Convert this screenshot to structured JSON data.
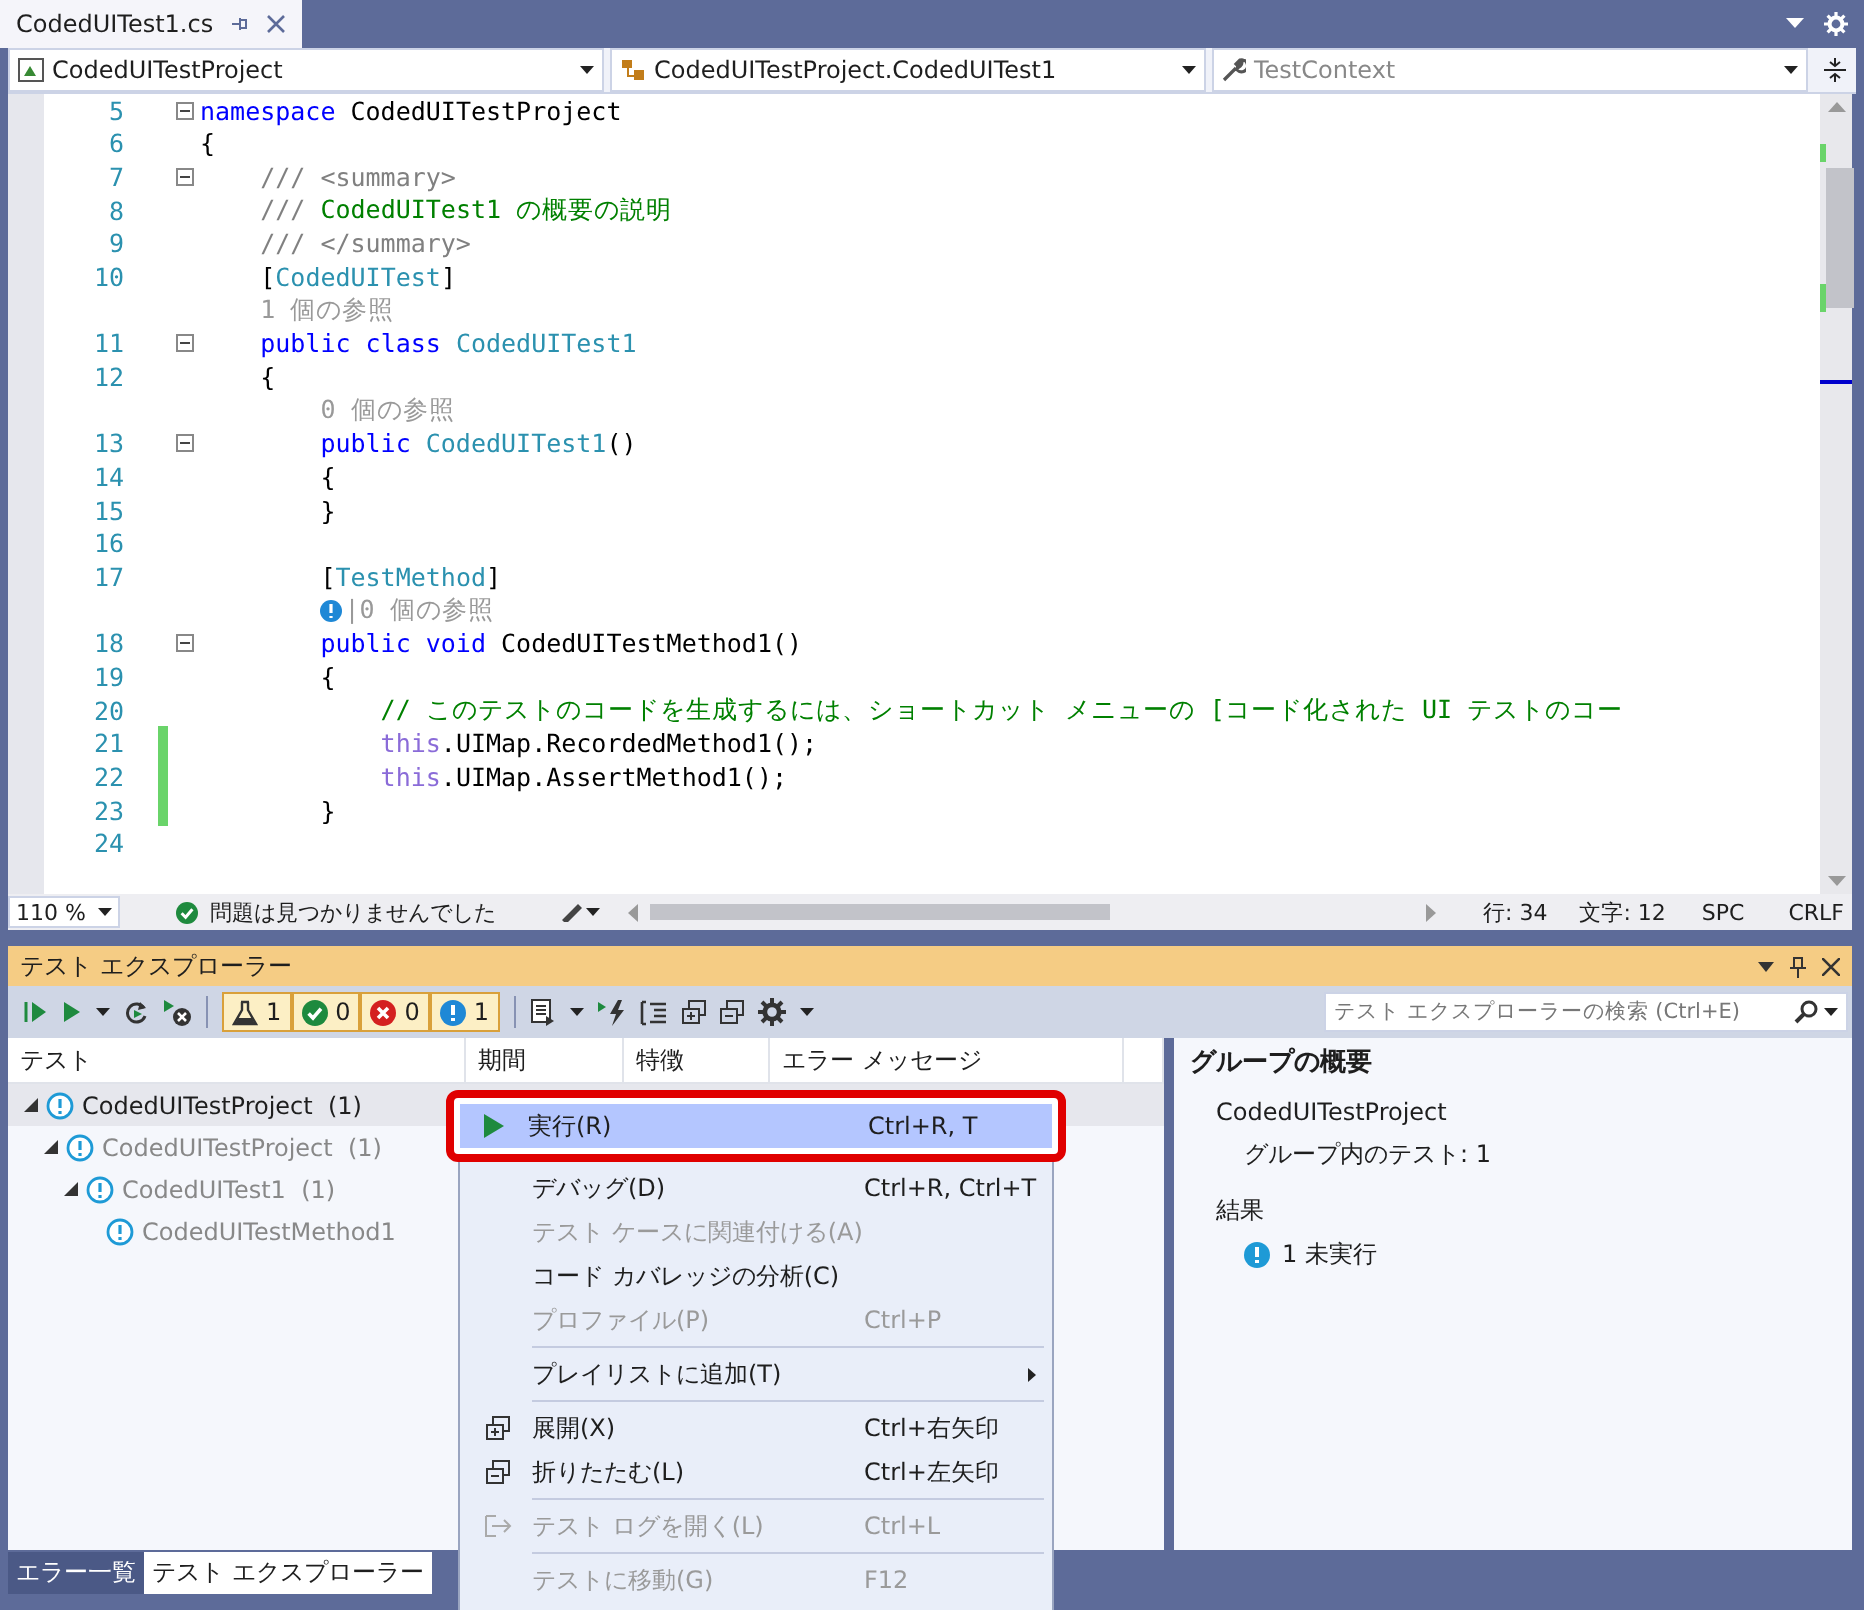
{
  "doc_tabs": [
    {
      "label": "CodedUITest1.cs",
      "selected": true
    }
  ],
  "nav_bar": {
    "dropdowns": [
      {
        "kind": "project",
        "text": "CodedUITestProject"
      },
      {
        "kind": "class",
        "text": "CodedUITestProject.CodedUITest1"
      },
      {
        "kind": "member",
        "text": "TestContext"
      }
    ]
  },
  "editor": {
    "lines": [
      {
        "kind": "code",
        "number": "5",
        "fold": true,
        "changed": false,
        "tokens": [
          {
            "kind": "keyword",
            "text": "namespace"
          },
          {
            "kind": "plain",
            "text": " CodedUITestProject"
          }
        ]
      },
      {
        "kind": "code",
        "number": "6",
        "fold": false,
        "changed": false,
        "tokens": [
          {
            "kind": "plain",
            "text": "{"
          }
        ]
      },
      {
        "kind": "code",
        "number": "7",
        "fold": true,
        "changed": false,
        "tokens": [
          {
            "kind": "doc",
            "text": "    /// <summary>"
          }
        ]
      },
      {
        "kind": "code",
        "number": "8",
        "fold": false,
        "changed": false,
        "tokens": [
          {
            "kind": "doc",
            "text": "    ///"
          },
          {
            "kind": "comment",
            "text": " CodedUITest1 の概要の説明"
          }
        ]
      },
      {
        "kind": "code",
        "number": "9",
        "fold": false,
        "changed": false,
        "tokens": [
          {
            "kind": "doc",
            "text": "    /// </summary>"
          }
        ]
      },
      {
        "kind": "code",
        "number": "10",
        "fold": false,
        "changed": false,
        "tokens": [
          {
            "kind": "plain",
            "text": "    ["
          },
          {
            "kind": "type",
            "text": "CodedUITest"
          },
          {
            "kind": "plain",
            "text": "]"
          }
        ]
      },
      {
        "kind": "lens",
        "text": "1 個の参照"
      },
      {
        "kind": "code",
        "number": "11",
        "fold": true,
        "changed": false,
        "tokens": [
          {
            "kind": "keyword",
            "text": "    public"
          },
          {
            "kind": "keyword",
            "text": " class"
          },
          {
            "kind": "type",
            "text": " CodedUITest1"
          }
        ]
      },
      {
        "kind": "code",
        "number": "12",
        "fold": false,
        "changed": false,
        "tokens": [
          {
            "kind": "plain",
            "text": "    {"
          }
        ]
      },
      {
        "kind": "lens",
        "text": "0 個の参照"
      },
      {
        "kind": "code",
        "number": "13",
        "fold": true,
        "changed": false,
        "tokens": [
          {
            "kind": "keyword",
            "text": "        public"
          },
          {
            "kind": "type",
            "text": " CodedUITest1"
          },
          {
            "kind": "plain",
            "text": "()"
          }
        ]
      },
      {
        "kind": "code",
        "number": "14",
        "fold": false,
        "changed": false,
        "tokens": [
          {
            "kind": "plain",
            "text": "        {"
          }
        ]
      },
      {
        "kind": "code",
        "number": "15",
        "fold": false,
        "changed": false,
        "tokens": [
          {
            "kind": "plain",
            "text": "        }"
          }
        ]
      },
      {
        "kind": "code",
        "number": "16",
        "fold": false,
        "changed": false
      },
      {
        "kind": "code",
        "number": "17",
        "fold": false,
        "changed": false,
        "tokens": [
          {
            "kind": "plain",
            "text": "        ["
          },
          {
            "kind": "type",
            "text": "TestMethod"
          },
          {
            "kind": "plain",
            "text": "]"
          }
        ]
      },
      {
        "kind": "lens_info",
        "text": "|0 個の参照"
      },
      {
        "kind": "code",
        "number": "18",
        "fold": true,
        "changed": false,
        "tokens": [
          {
            "kind": "keyword",
            "text": "        public"
          },
          {
            "kind": "keyword",
            "text": " void"
          },
          {
            "kind": "plain",
            "text": " CodedUITestMethod1()"
          }
        ]
      },
      {
        "kind": "code",
        "number": "19",
        "fold": false,
        "changed": false,
        "tokens": [
          {
            "kind": "plain",
            "text": "        {"
          }
        ]
      },
      {
        "kind": "code",
        "number": "20",
        "fold": false,
        "changed": false,
        "tokens": [
          {
            "kind": "comment",
            "text": "            // このテストのコードを生成するには、ショートカット メニューの [コード化された UI テストのコー"
          }
        ]
      },
      {
        "kind": "code",
        "number": "21",
        "fold": false,
        "changed": true,
        "tokens": [
          {
            "kind": "this",
            "text": "            this"
          },
          {
            "kind": "plain",
            "text": ".UIMap.RecordedMethod1();"
          }
        ]
      },
      {
        "kind": "code",
        "number": "22",
        "fold": false,
        "changed": true,
        "tokens": [
          {
            "kind": "this",
            "text": "            this"
          },
          {
            "kind": "plain",
            "text": ".UIMap.AssertMethod1();"
          }
        ]
      },
      {
        "kind": "code",
        "number": "23",
        "fold": false,
        "changed": true,
        "tokens": [
          {
            "kind": "plain",
            "text": "        }"
          }
        ]
      },
      {
        "kind": "code",
        "number": "24",
        "fold": false,
        "changed": false
      }
    ]
  },
  "editor_status": {
    "zoom": "110 %",
    "issues": "問題は見つかりませんでした",
    "line": "行: 34",
    "column": "文字: 12",
    "whitespace": "SPC",
    "line_ending": "CRLF"
  },
  "test_explorer": {
    "title": "テスト エクスプローラー",
    "filters": [
      {
        "kind": "all",
        "count": "1"
      },
      {
        "kind": "passed",
        "count": "0"
      },
      {
        "kind": "failed",
        "count": "0"
      },
      {
        "kind": "not_run",
        "count": "1"
      }
    ],
    "search": {
      "placeholder": "テスト エクスプローラーの検索 (Ctrl+E)"
    },
    "columns": [
      "テスト",
      "期間",
      "特徴",
      "エラー メッセージ"
    ],
    "tree": [
      {
        "label": "CodedUITestProject",
        "count": "(1)",
        "selected": true,
        "expanded": true,
        "children": [
          {
            "label": "CodedUITestProject",
            "count": "(1)",
            "selected": false,
            "expanded": true,
            "children": [
              {
                "label": "CodedUITest1",
                "count": "(1)",
                "selected": false,
                "expanded": true,
                "children": [
                  {
                    "label": "CodedUITestMethod1",
                    "selected": false
                  }
                ]
              }
            ]
          }
        ]
      }
    ],
    "summary": {
      "title": "グループの概要",
      "group": "CodedUITestProject",
      "tests_in_group": "グループ内のテスト: 1",
      "results_heading": "結果",
      "result": "1 未実行"
    }
  },
  "context_menu": [
    {
      "kind": "run",
      "label": "実行(R)",
      "shortcut": "Ctrl+R, T",
      "selected": true,
      "disabled": false,
      "annotated": true
    },
    {
      "kind": "item",
      "label": "デバッグ(D)",
      "shortcut": "Ctrl+R, Ctrl+T",
      "selected": false,
      "disabled": false
    },
    {
      "kind": "item",
      "label": "テスト ケースに関連付ける(A)",
      "selected": false,
      "disabled": true
    },
    {
      "kind": "item",
      "label": "コード カバレッジの分析(C)",
      "selected": false,
      "disabled": false
    },
    {
      "kind": "item",
      "label": "プロファイル(P)",
      "shortcut": "Ctrl+P",
      "selected": false,
      "disabled": true
    },
    {
      "kind": "separator"
    },
    {
      "kind": "submenu",
      "label": "プレイリストに追加(T)",
      "selected": false,
      "disabled": false
    },
    {
      "kind": "separator"
    },
    {
      "kind": "expand",
      "label": "展開(X)",
      "shortcut": "Ctrl+右矢印",
      "selected": false,
      "disabled": false
    },
    {
      "kind": "collapse",
      "label": "折りたたむ(L)",
      "shortcut": "Ctrl+左矢印",
      "selected": false,
      "disabled": false
    },
    {
      "kind": "separator"
    },
    {
      "kind": "log",
      "label": "テスト ログを開く(L)",
      "shortcut": "Ctrl+L",
      "selected": false,
      "disabled": true
    },
    {
      "kind": "separator"
    },
    {
      "kind": "item",
      "label": "テストに移動(G)",
      "shortcut": "F12",
      "selected": false,
      "disabled": true
    }
  ],
  "bottom_tabs": [
    {
      "label": "エラー一覧",
      "selected": false
    },
    {
      "label": "テスト エクスプローラー",
      "selected": true
    }
  ]
}
